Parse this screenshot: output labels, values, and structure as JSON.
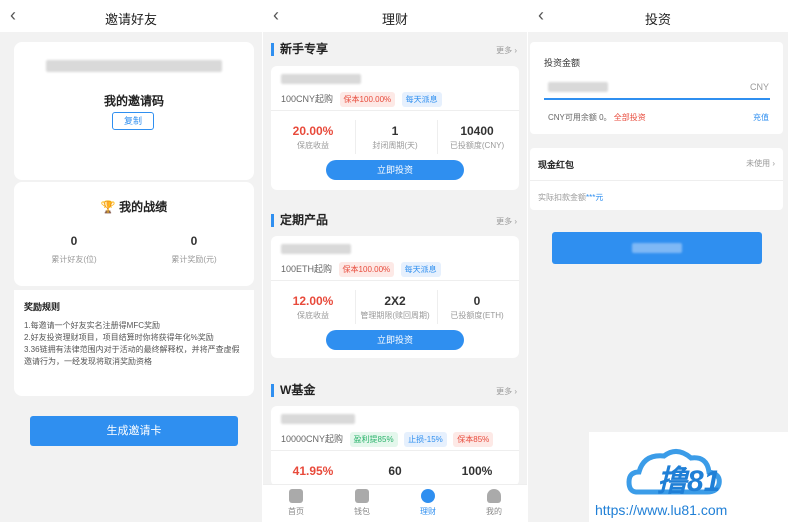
{
  "invite": {
    "title": "邀请好友",
    "my_code_label": "我的邀请码",
    "copy_button": "复制",
    "achievements_title": "我的战绩",
    "stats": [
      {
        "value": "0",
        "label": "累计好友(位)"
      },
      {
        "value": "0",
        "label": "累计奖励(元)"
      }
    ],
    "rules_title": "奖励规则",
    "rules": [
      "1.每邀请一个好友实名注册得MFC奖励",
      "2.好友投资理财项目，项目结算时你将获得年化%奖励",
      "3.36链拥有法律范围内对于活动的最终解释权，并将严查虚假邀请行为，一经发现将取消奖励资格"
    ],
    "generate_button": "生成邀请卡"
  },
  "finance": {
    "title": "理财",
    "more_label": "更多",
    "sections": [
      {
        "name": "新手专享",
        "product": {
          "min": "100CNY起购",
          "tags": [
            {
              "text": "保本100.00%",
              "style": "red"
            },
            {
              "text": "每天派息",
              "style": "blue"
            }
          ],
          "stats": [
            {
              "value": "20.00%",
              "label": "保底收益",
              "highlight": true
            },
            {
              "value": "1",
              "label": "封闭周期(天)",
              "highlight": false
            },
            {
              "value": "10400",
              "label": "已投额度(CNY)",
              "highlight": false
            }
          ],
          "button": "立即投资"
        }
      },
      {
        "name": "定期产品",
        "product": {
          "min": "100ETH起购",
          "tags": [
            {
              "text": "保本100.00%",
              "style": "red"
            },
            {
              "text": "每天派息",
              "style": "blue"
            }
          ],
          "stats": [
            {
              "value": "12.00%",
              "label": "保底收益",
              "highlight": true
            },
            {
              "value": "2X2",
              "label": "管理期限(赎回周期)",
              "highlight": false
            },
            {
              "value": "0",
              "label": "已投额度(ETH)",
              "highlight": false
            }
          ],
          "button": "立即投资"
        }
      },
      {
        "name": "W基金",
        "product": {
          "min": "10000CNY起购",
          "tags": [
            {
              "text": "盈利提85%",
              "style": "green"
            },
            {
              "text": "止损-15%",
              "style": "blue"
            },
            {
              "text": "保本85%",
              "style": "red"
            }
          ],
          "stats": [
            {
              "value": "41.95%",
              "label": "",
              "highlight": true
            },
            {
              "value": "60",
              "label": "",
              "highlight": false
            },
            {
              "value": "100%",
              "label": "",
              "highlight": false
            }
          ]
        }
      }
    ],
    "tabs": [
      {
        "label": "首页",
        "active": false
      },
      {
        "label": "钱包",
        "active": false
      },
      {
        "label": "理财",
        "active": true
      },
      {
        "label": "我的",
        "active": false
      }
    ]
  },
  "invest": {
    "title": "投资",
    "amount_label": "投资金额",
    "currency": "CNY",
    "available_text": "CNY可用余额 0。",
    "all_in_link": "全部投资",
    "recharge_link": "充值",
    "red_packet_label": "现金红包",
    "unused_label": "未使用",
    "deduct_prefix": "实际扣款金额",
    "deduct_value": "***元"
  },
  "watermark": {
    "logo_text": "撸81",
    "url": "https://www.lu81.com"
  },
  "colors": {
    "accent": "#2f8ff0",
    "highlight": "#e84a3b",
    "background": "#f2f2f2"
  }
}
